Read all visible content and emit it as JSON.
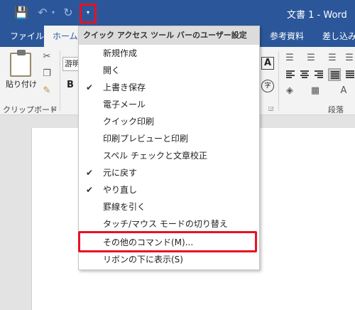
{
  "titlebar": {
    "doc_title": "文書 1 - Word",
    "save_icon": "💾",
    "undo_icon": "↶",
    "undo_dropdown": "▾",
    "redo_icon": "↻",
    "customize_icon": "▾"
  },
  "tabs": {
    "file": "ファイル",
    "home": "ホーム",
    "references": "参考資料",
    "mailings": "差し込み"
  },
  "ribbon": {
    "paste_label": "貼り付け",
    "clipboard_label": "クリップボード",
    "font_name": "游明",
    "bold": "B",
    "paragraph_label": "段落",
    "a_box": "A",
    "circle_char": "字"
  },
  "menu": {
    "header": "クイック アクセス ツール バーのユーザー設定",
    "items": [
      {
        "label": "新規作成",
        "checked": false
      },
      {
        "label": "開く",
        "checked": false
      },
      {
        "label": "上書き保存",
        "checked": true
      },
      {
        "label": "電子メール",
        "checked": false
      },
      {
        "label": "クイック印刷",
        "checked": false
      },
      {
        "label": "印刷プレビューと印刷",
        "checked": false
      },
      {
        "label": "スペル チェックと文章校正",
        "checked": false
      },
      {
        "label": "元に戻す",
        "checked": true
      },
      {
        "label": "やり直し",
        "checked": true
      },
      {
        "label": "罫線を引く",
        "checked": false
      },
      {
        "label": "タッチ/マウス モードの切り替え",
        "checked": false
      }
    ],
    "more_commands": "その他のコマンド(M)...",
    "show_below": "リボンの下に表示(S)",
    "check_glyph": "✔"
  },
  "colors": {
    "title_bar": "#2b579a",
    "highlight": "#e81123"
  }
}
